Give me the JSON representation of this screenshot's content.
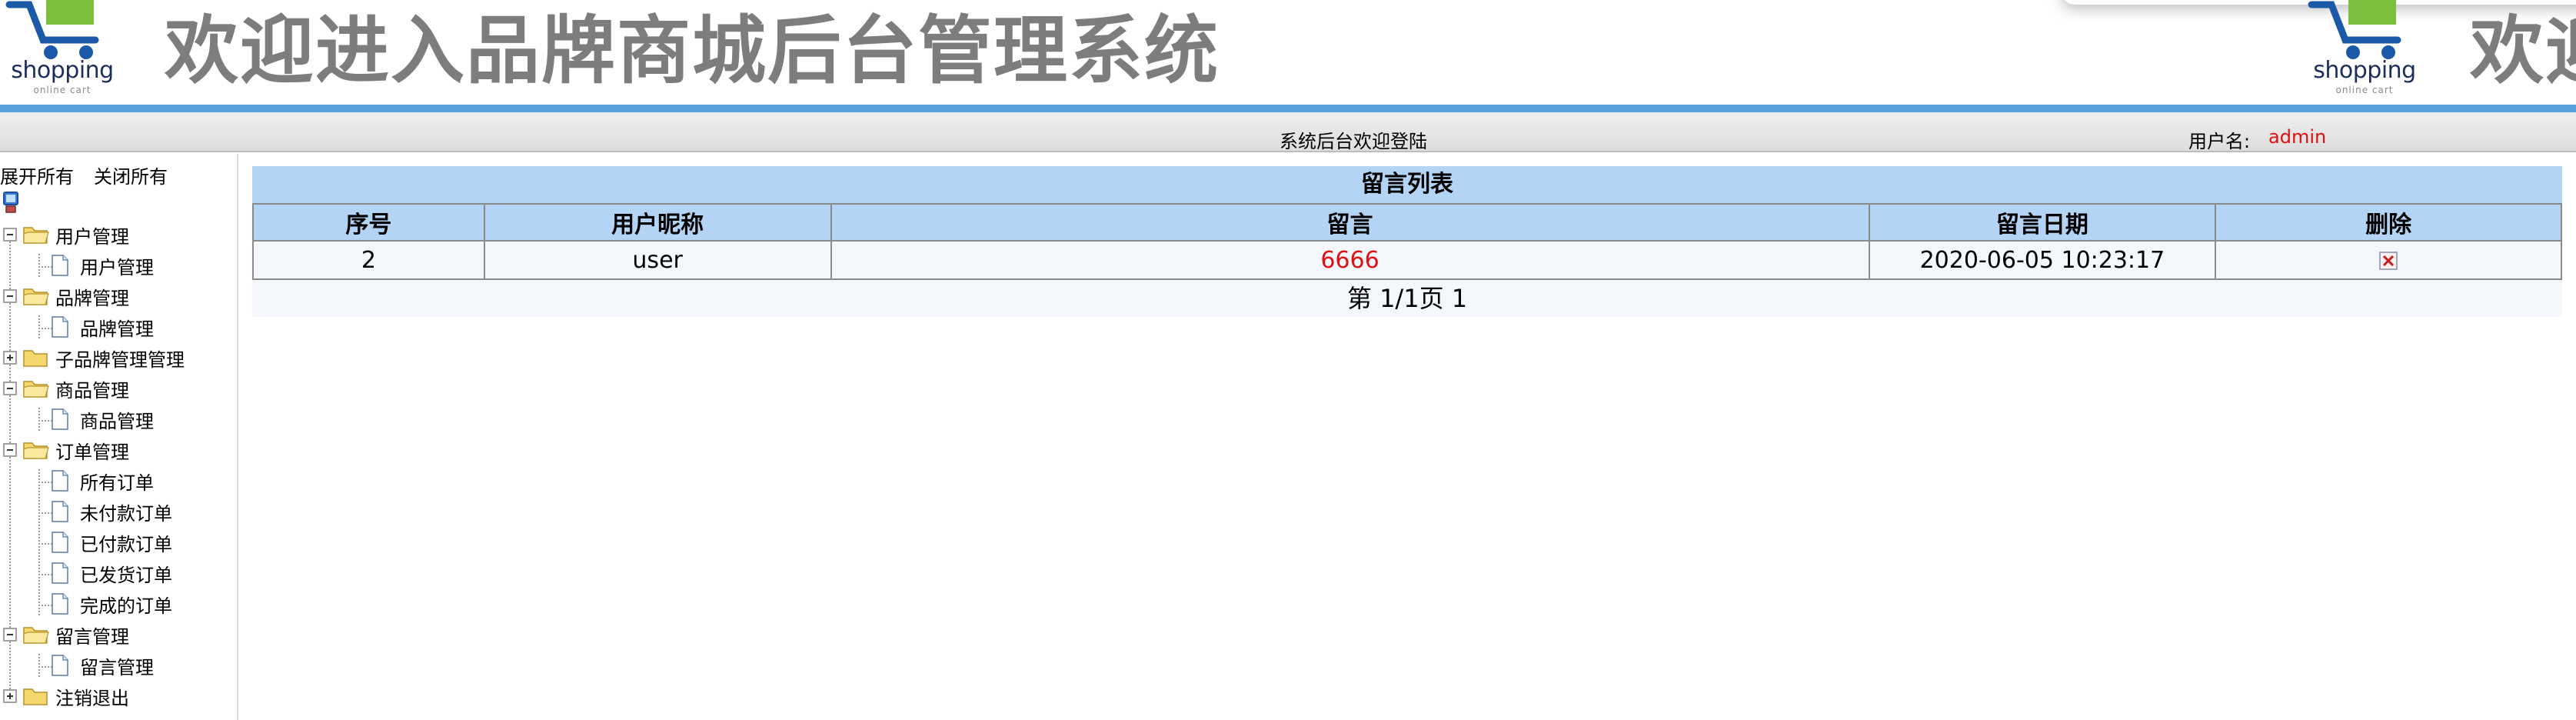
{
  "banner": {
    "logo_word": "shopping",
    "logo_sub": "online cart",
    "title": "欢迎进入品牌商城后台管理系统",
    "title_repeat": "欢迎"
  },
  "statusbar": {
    "welcome": "系统后台欢迎登陆",
    "user_label": "用户名:",
    "user_name": "admin"
  },
  "sidebar": {
    "expand_all": "展开所有",
    "collapse_all": "关闭所有",
    "groups": [
      {
        "label": "用户管理",
        "expanded": true,
        "children": [
          "用户管理"
        ]
      },
      {
        "label": "品牌管理",
        "expanded": true,
        "children": [
          "品牌管理"
        ]
      },
      {
        "label": "子品牌管理管理",
        "expanded": false,
        "children": []
      },
      {
        "label": "商品管理",
        "expanded": true,
        "children": [
          "商品管理"
        ]
      },
      {
        "label": "订单管理",
        "expanded": true,
        "children": [
          "所有订单",
          "未付款订单",
          "已付款订单",
          "已发货订单",
          "完成的订单"
        ]
      },
      {
        "label": "留言管理",
        "expanded": true,
        "children": [
          "留言管理"
        ]
      },
      {
        "label": "注销退出",
        "expanded": false,
        "children": []
      }
    ]
  },
  "main": {
    "list_title": "留言列表",
    "columns": [
      "序号",
      "用户昵称",
      "留言",
      "留言日期",
      "删除"
    ],
    "rows": [
      {
        "id": "2",
        "nickname": "user",
        "message": "6666",
        "date": "2020-06-05 10:23:17"
      }
    ],
    "pager": "第 1/1页 1"
  },
  "colors": {
    "accent_bar": "#5aa0dc",
    "table_header": "#b3d4f5",
    "highlight_red": "#e01010"
  }
}
